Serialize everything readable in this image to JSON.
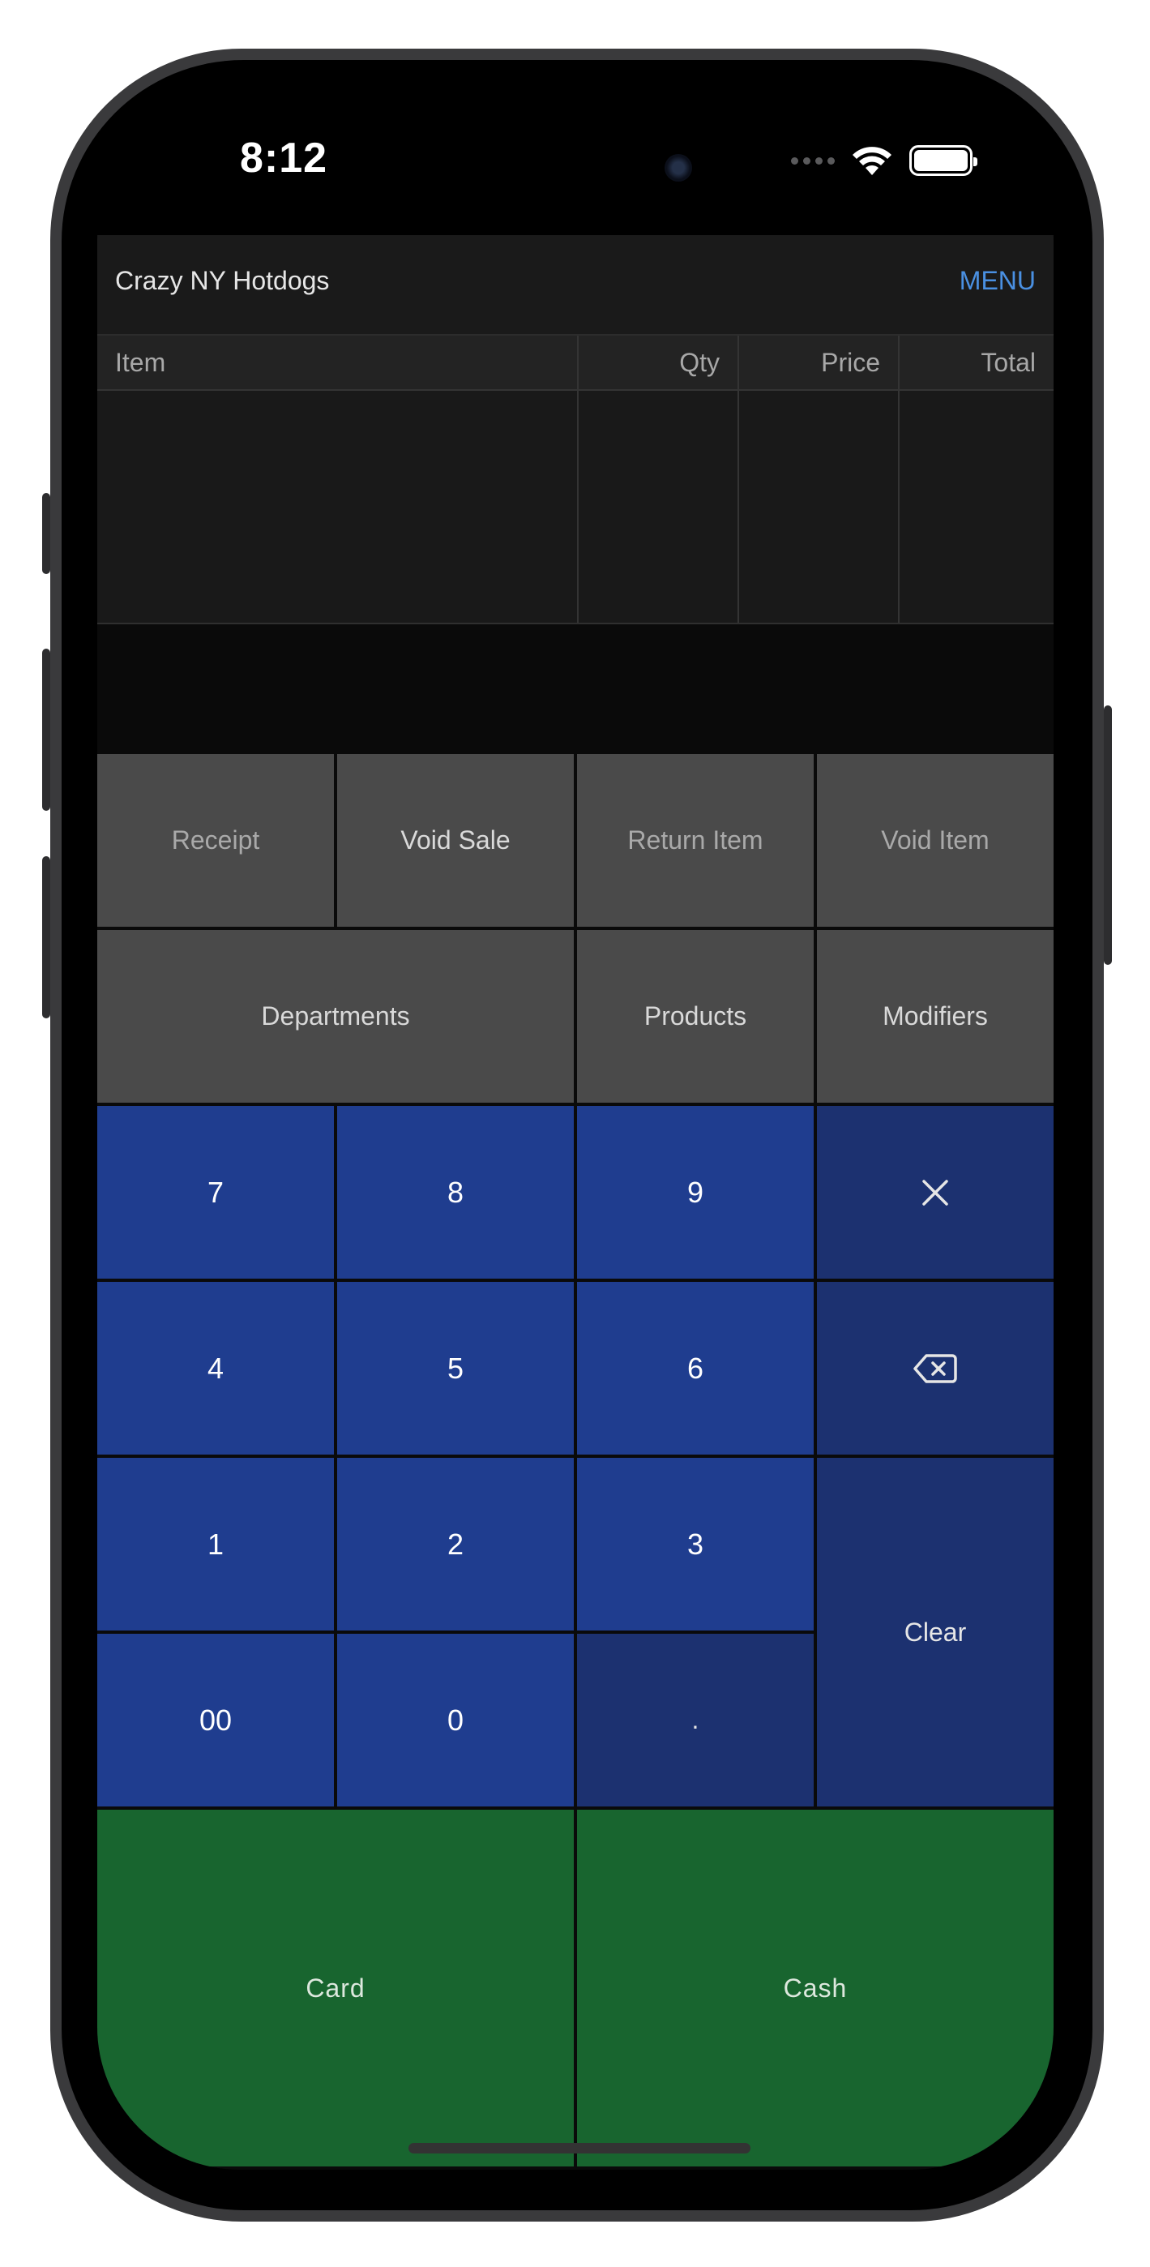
{
  "status_bar": {
    "time": "8:12"
  },
  "nav": {
    "title": "Crazy NY Hotdogs",
    "menu_label": "MENU"
  },
  "table": {
    "headers": [
      "Item",
      "Qty",
      "Price",
      "Total"
    ]
  },
  "actions": {
    "receipt": "Receipt",
    "void_sale": "Void Sale",
    "return_item": "Return Item",
    "void_item": "Void Item",
    "departments": "Departments",
    "products": "Products",
    "modifiers": "Modifiers"
  },
  "keypad": {
    "k7": "7",
    "k8": "8",
    "k9": "9",
    "k4": "4",
    "k5": "5",
    "k6": "6",
    "k1": "1",
    "k2": "2",
    "k3": "3",
    "k00": "00",
    "k0": "0",
    "kdot": ".",
    "clear": "Clear",
    "multiply_icon": "multiply-icon",
    "backspace_icon": "backspace-icon"
  },
  "payment": {
    "card": "Card",
    "cash": "Cash"
  },
  "colors": {
    "keypad_blue": "#1f3d8f",
    "keypad_navy": "#1c3170",
    "pay_green": "#18652f",
    "action_gray": "#4a4a4a",
    "menu_blue": "#4a90e2"
  }
}
